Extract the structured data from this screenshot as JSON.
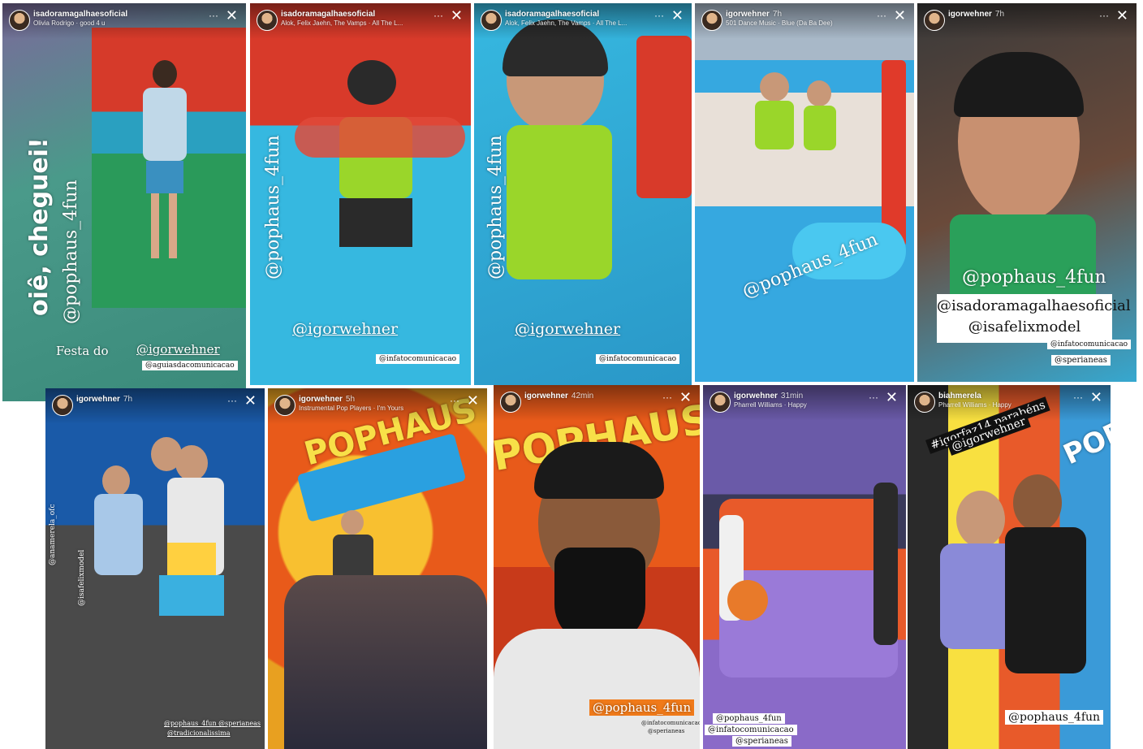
{
  "stories": [
    {
      "user": "igorwehner",
      "overlay_user": "isadoramagalhaesoficial",
      "music": "Olivia Rodrigo · good 4 u",
      "stickers": [
        "oiê, cheguei!",
        "@pophaus_4fun",
        "Festa do",
        "@igorwehner",
        "@aguiasdacomunicacao"
      ]
    },
    {
      "user": "isadoramagalhaesoficial",
      "music": "Alok, Felix Jaehn, The Vamps · All The L...",
      "stickers": [
        "@pophaus_4fun",
        "@igorwehner",
        "@infatocomunicacao"
      ]
    },
    {
      "user": "isadoramagalhaesoficial",
      "music": "Alok, Felix Jaehn, The Vamps · All The L...",
      "stickers": [
        "@pophaus_4fun",
        "@igorwehner",
        "@infatocomunicacao"
      ]
    },
    {
      "user": "igorwehner",
      "time": "7h",
      "music": "501 Dance Music · Blue (Da Ba Dee)",
      "stickers": [
        "@pophaus_4fun"
      ]
    },
    {
      "user": "igorwehner",
      "time": "7h",
      "stickers": [
        "@pophaus_4fun",
        "@isadoramagalhaesoficial",
        "@isafelixmodel",
        "@infatocomunicacao",
        "@sperianeas"
      ]
    },
    {
      "user": "igorwehner",
      "time": "7h",
      "stickers": [
        "@anamerela_ofc",
        "@isafelixmodel",
        "@pophaus_4fun @sperianeas",
        "@tradicionalissima"
      ]
    },
    {
      "user": "igorwehner",
      "time": "5h",
      "music": "Instrumental Pop Players · I'm Yours",
      "stickers": [
        "POPHAUS"
      ]
    },
    {
      "user": "igorwehner",
      "time": "42min",
      "stickers": [
        "POPHAUS",
        "@pophaus_4fun",
        "@infatocomunicacao",
        "@sperianeas"
      ]
    },
    {
      "user": "igorwehner",
      "time": "31min",
      "music": "Pharrell Williams · Happy",
      "stickers": [
        "@pophaus_4fun",
        "@infatocomunicacao",
        "@sperianeas"
      ]
    },
    {
      "user": "biahmerela",
      "music": "Pharrell Williams · Happy",
      "stickers": [
        "#igorfaz14 parabéns",
        "@igorwehner",
        "POP",
        "@pophaus_4fun"
      ]
    }
  ],
  "ui": {
    "more": "···",
    "close": "✕"
  }
}
